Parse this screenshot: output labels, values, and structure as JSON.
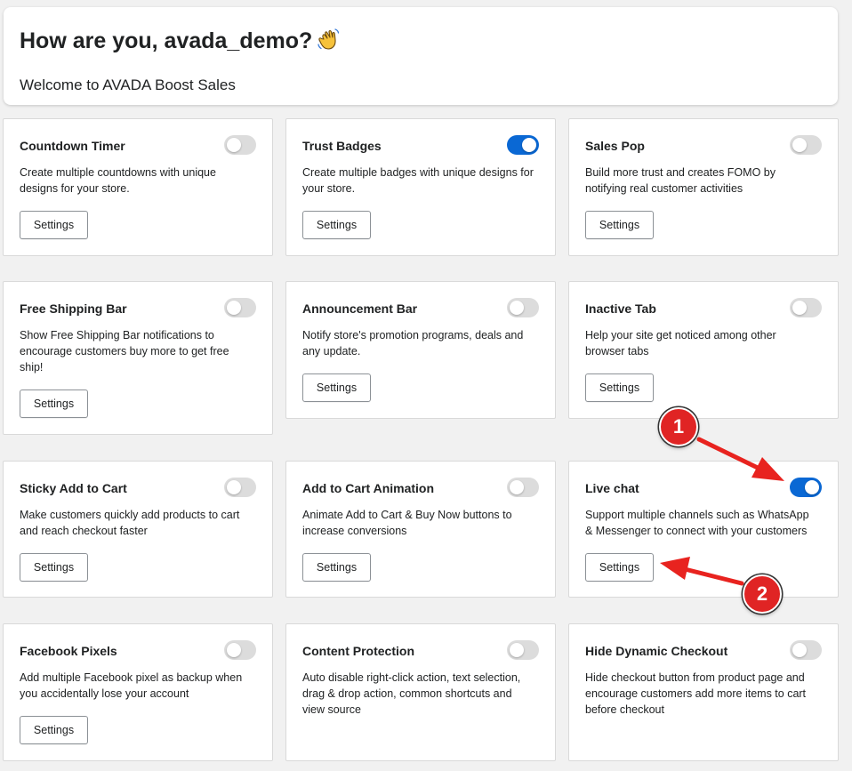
{
  "header": {
    "greeting": "How are you, avada_demo?",
    "subtitle": "Welcome to AVADA Boost Sales"
  },
  "button_label": "Settings",
  "cards": [
    {
      "title": "Countdown Timer",
      "desc": "Create multiple countdowns with unique designs for your store.",
      "enabled": false
    },
    {
      "title": "Trust Badges",
      "desc": "Create multiple badges with unique designs for your store.",
      "enabled": true
    },
    {
      "title": "Sales Pop",
      "desc": "Build more trust and creates FOMO by notifying real customer activities",
      "enabled": false
    },
    {
      "title": "Free Shipping Bar",
      "desc": "Show Free Shipping Bar notifications to encourage customers buy more to get free ship!",
      "enabled": false
    },
    {
      "title": "Announcement Bar",
      "desc": "Notify store's promotion programs, deals and any update.",
      "enabled": false
    },
    {
      "title": "Inactive Tab",
      "desc": "Help your site get noticed among other browser tabs",
      "enabled": false
    },
    {
      "title": "Sticky Add to Cart",
      "desc": "Make customers quickly add products to cart and reach checkout faster",
      "enabled": false
    },
    {
      "title": "Add to Cart Animation",
      "desc": "Animate Add to Cart & Buy Now buttons to increase conversions",
      "enabled": false
    },
    {
      "title": "Live chat",
      "desc": "Support multiple channels such as WhatsApp & Messenger to connect with your customers",
      "enabled": true
    },
    {
      "title": "Facebook Pixels",
      "desc": "Add multiple Facebook pixel as backup when you accidentally lose your account",
      "enabled": false
    },
    {
      "title": "Content Protection",
      "desc": "Auto disable right-click action, text selection, drag & drop action, common shortcuts and view source",
      "enabled": false
    },
    {
      "title": "Hide Dynamic Checkout",
      "desc": "Hide checkout button from product page and encourage customers add more items to cart before checkout",
      "enabled": false
    }
  ],
  "annotations": [
    {
      "label": "1",
      "color": "#e02424"
    },
    {
      "label": "2",
      "color": "#e02424"
    }
  ],
  "colors": {
    "toggle_on": "#0a68d4",
    "toggle_off": "#dcdcdc",
    "annotation": "#e02424"
  }
}
